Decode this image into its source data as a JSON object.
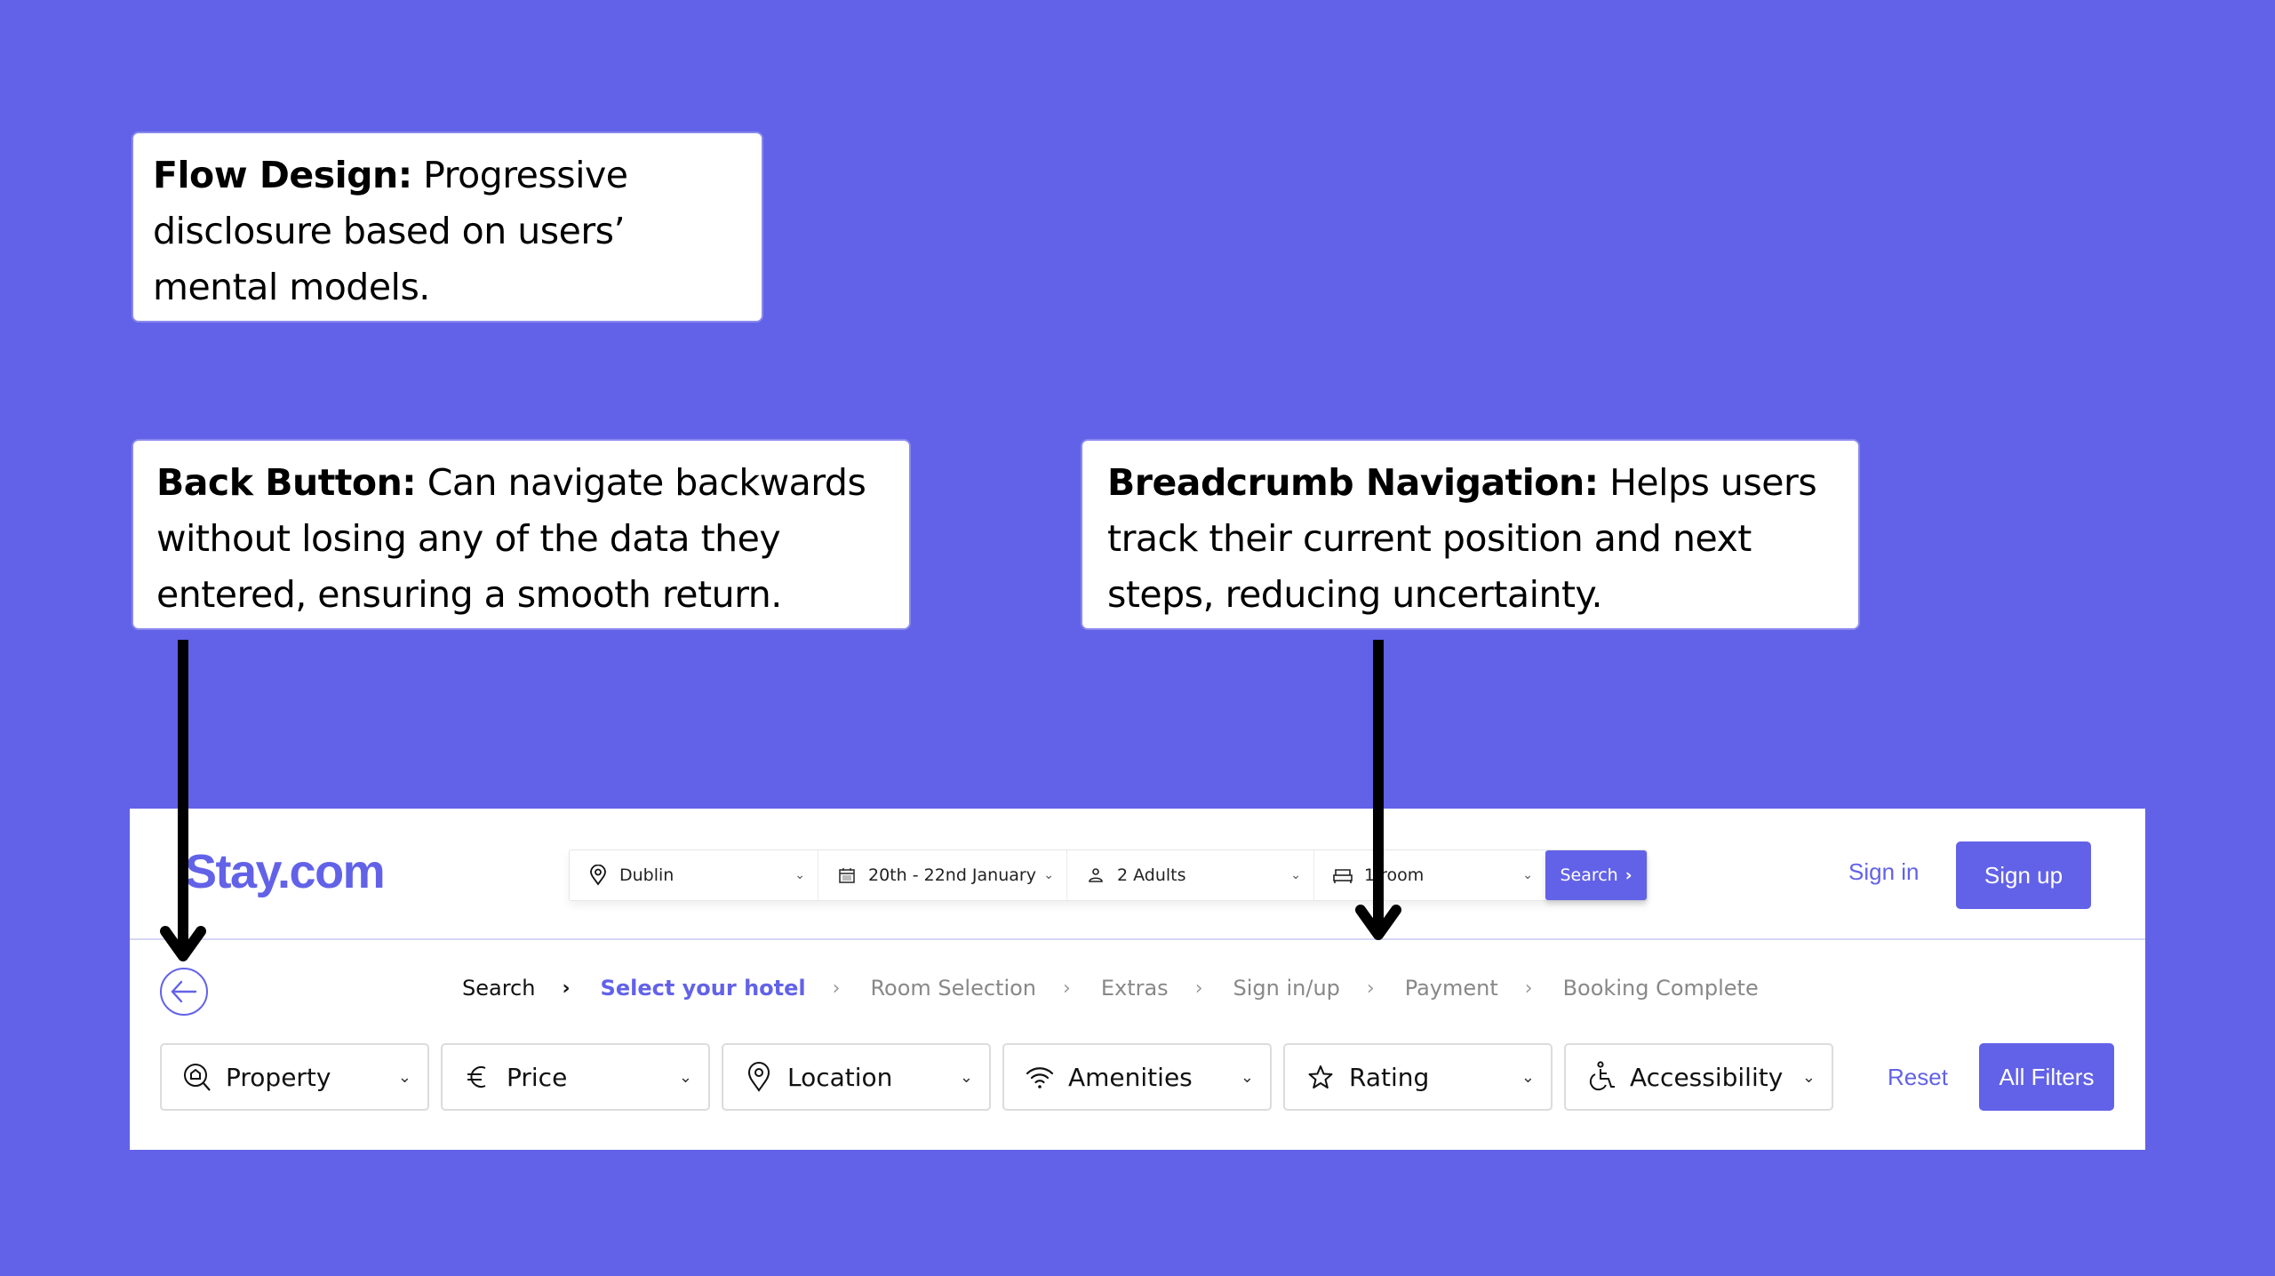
{
  "annotations": {
    "flow_design": {
      "title": "Flow Design:",
      "body": " Progressive disclosure based on users’ mental models."
    },
    "back_button": {
      "title": "Back Button:",
      "body": " Can navigate backwards without losing any of the data they entered, ensuring a smooth return."
    },
    "breadcrumb_navigation": {
      "title": "Breadcrumb Navigation:",
      "body": " Helps users track their current position and next steps, reducing uncertainty."
    }
  },
  "header": {
    "logo": "Stay.com",
    "search": {
      "location": {
        "icon": "map-pin-icon",
        "value": "Dublin"
      },
      "dates": {
        "icon": "calendar-icon",
        "value": "20th - 22nd January"
      },
      "guests": {
        "icon": "person-icon",
        "value": "2  Adults"
      },
      "rooms": {
        "icon": "bed-icon",
        "value": "1 room"
      },
      "button_label": "Search"
    },
    "sign_in": "Sign in",
    "sign_up": "Sign up"
  },
  "breadcrumb": {
    "steps": [
      {
        "label": "Search",
        "state": "done"
      },
      {
        "label": "Select your hotel",
        "state": "current"
      },
      {
        "label": "Room Selection",
        "state": "upcoming"
      },
      {
        "label": "Extras",
        "state": "upcoming"
      },
      {
        "label": "Sign in/up",
        "state": "upcoming"
      },
      {
        "label": "Payment",
        "state": "upcoming"
      },
      {
        "label": "Booking Complete",
        "state": "upcoming"
      }
    ],
    "separator": "›"
  },
  "filters": {
    "items": [
      {
        "label": "Property",
        "icon": "property-search-icon"
      },
      {
        "label": "Price",
        "icon": "euro-icon"
      },
      {
        "label": "Location",
        "icon": "map-pin-icon"
      },
      {
        "label": "Amenities",
        "icon": "wifi-icon"
      },
      {
        "label": "Rating",
        "icon": "star-icon"
      },
      {
        "label": "Accessibility",
        "icon": "wheelchair-icon"
      }
    ],
    "reset": "Reset",
    "all_filters": "All Filters"
  },
  "colors": {
    "accent": "#6262e8",
    "background": "#6262e8",
    "text": "#111111",
    "muted": "#888888"
  }
}
